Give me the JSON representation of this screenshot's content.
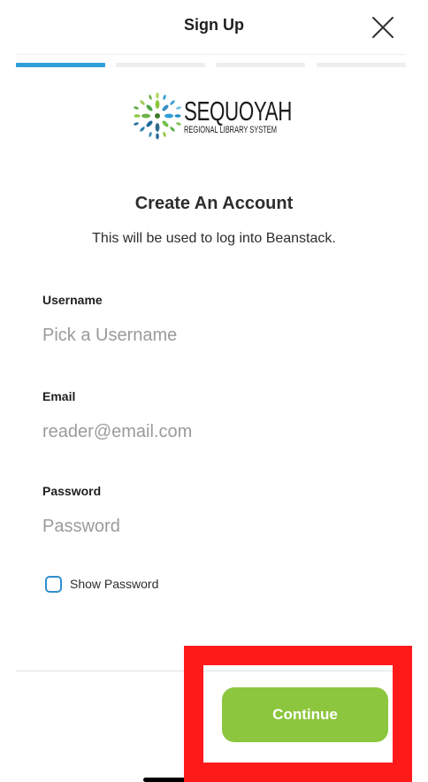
{
  "header": {
    "title": "Sign Up",
    "close_icon": "close-icon"
  },
  "progress": {
    "total_steps": 4,
    "current_step": 1,
    "active_color": "#2f9fd8",
    "inactive_color": "#eeeeee"
  },
  "logo": {
    "main": "SEQUOYAH",
    "sub": "REGIONAL LIBRARY SYSTEM",
    "icon": "tree-leaves-logo"
  },
  "main": {
    "heading": "Create An Account",
    "subheading": "This will be used to log into Beanstack."
  },
  "form": {
    "username": {
      "label": "Username",
      "placeholder": "Pick a Username",
      "value": ""
    },
    "email": {
      "label": "Email",
      "placeholder": "reader@email.com",
      "value": ""
    },
    "password": {
      "label": "Password",
      "placeholder": "Password",
      "value": ""
    },
    "show_password": {
      "label": "Show Password",
      "checked": false
    }
  },
  "footer": {
    "continue_label": "Continue"
  },
  "colors": {
    "accent_green": "#8cc63e",
    "checkbox_blue": "#2f8fd0",
    "highlight_red": "#ff1a1a"
  }
}
